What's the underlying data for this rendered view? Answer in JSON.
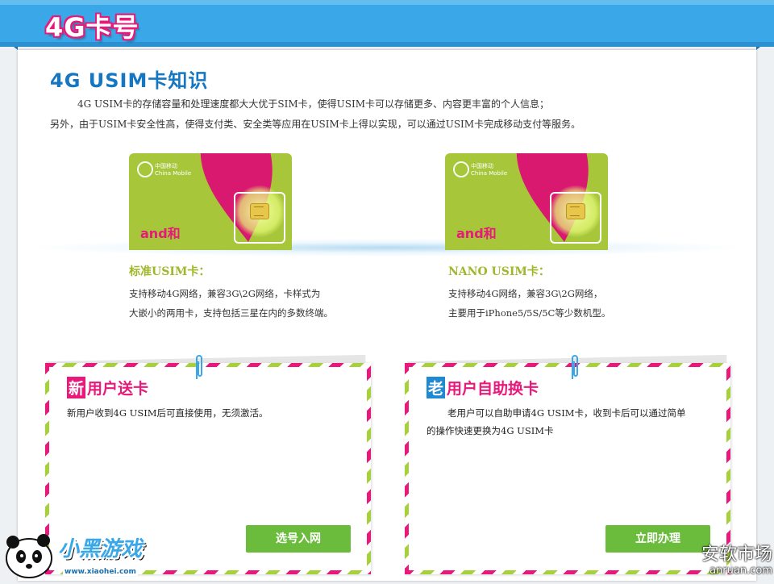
{
  "banner": {
    "title": "4G卡号"
  },
  "section": {
    "title": "4G USIM卡知识",
    "intro_line1": "4G USIM卡的存储容量和处理速度都大大优于SIM卡，使得USIM卡可以存储更多、内容更丰富的个人信息；",
    "intro_line2": "另外，由于USIM卡安全性高，使得支付类、安全类等应用在USIM卡上得以实现，可以通过USIM卡完成移动支付等服务。"
  },
  "cards": [
    {
      "carrier": "中国移动",
      "carrier_en": "China Mobile",
      "brand": "and和",
      "title": "标准USIM卡：",
      "desc_line1": "支持移动4G网络，兼容3G\\2G网络，卡样式为",
      "desc_line2": "大嵌小的两用卡，支持包括三星在内的多数终端。"
    },
    {
      "carrier": "中国移动",
      "carrier_en": "China Mobile",
      "brand": "and和",
      "title": "NANO USIM卡：",
      "desc_line1": "支持移动4G网络，兼容3G\\2G网络，",
      "desc_line2": "主要用于iPhone5/5S/5C等少数机型。"
    }
  ],
  "offers": [
    {
      "badge": "新",
      "title": "用户送卡",
      "text_line1": "新用户收到4G USIM后可直接使用，无须激活。",
      "text_line2": "",
      "button": "选号入网"
    },
    {
      "badge": "老",
      "title": "用户自助换卡",
      "text_line1": "老用户可以自助申请4G USIM卡，收到卡后可以通过简单",
      "text_line2": "的操作快速更换为4G USIM卡",
      "button": "立即办理"
    }
  ],
  "watermarks": {
    "left_brand": "小黑游戏",
    "left_url": "www.xiaohei.com",
    "right_brand": "安软市场",
    "right_url": "anruan.com"
  },
  "colors": {
    "banner_blue": "#3aa7e8",
    "title_blue": "#1577c2",
    "pink": "#e8197a",
    "green": "#6bbb3d",
    "olive": "#a0b72a",
    "badge_blue": "#1f8ad3"
  }
}
